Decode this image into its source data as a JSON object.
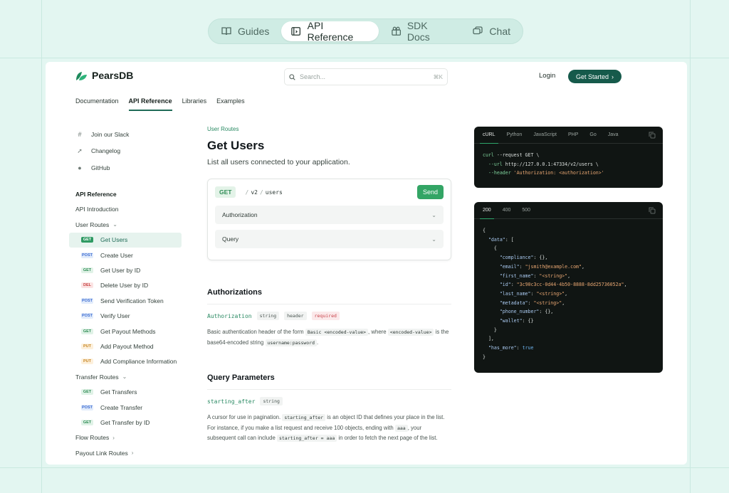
{
  "topnav": {
    "tabs": [
      {
        "label": "Guides",
        "icon": "book-icon",
        "active": false
      },
      {
        "label": "API Reference",
        "icon": "code-square-icon",
        "active": true
      },
      {
        "label": "SDK Docs",
        "icon": "package-icon",
        "active": false
      },
      {
        "label": "Chat",
        "icon": "chat-icon",
        "active": false
      }
    ]
  },
  "header": {
    "brand": "PearsDB",
    "search_placeholder": "Search...",
    "search_shortcut": "⌘K",
    "login": "Login",
    "get_started": "Get Started",
    "get_started_arrow": "›"
  },
  "subnav": {
    "items": [
      "Documentation",
      "API Reference",
      "Libraries",
      "Examples"
    ],
    "active": "API Reference"
  },
  "sidebar": {
    "links": [
      {
        "label": "Join our Slack",
        "icon": "slack-icon"
      },
      {
        "label": "Changelog",
        "icon": "rocket-icon"
      },
      {
        "label": "GitHub",
        "icon": "github-icon"
      }
    ],
    "heading": "API Reference",
    "intro": "API Introduction",
    "user_routes": {
      "label": "User Routes",
      "items": [
        {
          "method": "GET",
          "label": "Get Users",
          "active": true
        },
        {
          "method": "POST",
          "label": "Create User"
        },
        {
          "method": "GET",
          "label": "Get User by ID"
        },
        {
          "method": "DEL",
          "label": "Delete User by ID"
        },
        {
          "method": "POST",
          "label": "Send Verification Token"
        },
        {
          "method": "POST",
          "label": "Verify User"
        },
        {
          "method": "GET",
          "label": "Get Payout Methods"
        },
        {
          "method": "PUT",
          "label": "Add Payout Method"
        },
        {
          "method": "PUT",
          "label": "Add Compliance Information"
        }
      ]
    },
    "transfer_routes": {
      "label": "Transfer Routes",
      "items": [
        {
          "method": "GET",
          "label": "Get Transfers"
        },
        {
          "method": "POST",
          "label": "Create Transfer"
        },
        {
          "method": "GET",
          "label": "Get Transfer by ID"
        }
      ]
    },
    "flow_routes": "Flow Routes",
    "payout_link_routes": "Payout Link Routes"
  },
  "main": {
    "eyebrow": "User Routes",
    "title": "Get Users",
    "description": "List all users connected to your application.",
    "request": {
      "method": "GET",
      "path_parts": [
        "v2",
        "users"
      ],
      "send": "Send",
      "accordions": [
        "Authorization",
        "Query"
      ]
    },
    "authorizations": {
      "title": "Authorizations",
      "param": "Authorization",
      "type": "string",
      "location": "header",
      "required": "required",
      "desc_1": "Basic authentication header of the form",
      "code_1": "Basic <encoded-value>",
      "desc_2": ", where",
      "code_2": "<encoded-value>",
      "desc_3": "is the base64-encoded string",
      "code_3": "username:password",
      "desc_4": "."
    },
    "query": {
      "title": "Query Parameters",
      "param": "starting_after",
      "type": "string",
      "desc_1": "A cursor for use in pagination.",
      "code_1": "starting_after",
      "desc_2": "is an object ID that defines your place in the list. For instance, if you make a list request and receive 100 objects, ending with",
      "code_2": "aaa",
      "desc_3": ", your subsequent call can include",
      "code_3": "starting_after = aaa",
      "desc_4": "in order to fetch the next page of the list."
    }
  },
  "request_panel": {
    "tabs": [
      "cURL",
      "Python",
      "JavaScript",
      "PHP",
      "Go",
      "Java"
    ],
    "active": "cURL",
    "line1_cmd": "curl",
    "line1_rest": " --request GET \\",
    "line2_flag": "  --url",
    "line2_rest": " http://127.0.0.1:47334/v2/users \\",
    "line3_flag": "  --header",
    "line3_str": " 'Authorization: <authorization>'"
  },
  "response_panel": {
    "tabs": [
      "200",
      "400",
      "500"
    ],
    "active": "200",
    "fields": {
      "data": "\"data\"",
      "compliance": "\"compliance\"",
      "email_key": "\"email\"",
      "email_val": "\"jsmith@example.com\"",
      "first_name_key": "\"first_name\"",
      "string_val": "\"<string>\"",
      "id_key": "\"id\"",
      "id_val": "\"3c90c3cc-0d44-4b50-8888-8dd25736052a\"",
      "last_name_key": "\"last_name\"",
      "metadata_key": "\"metadata\"",
      "phone_key": "\"phone_number\"",
      "wallet_key": "\"wallet\"",
      "has_more_key": "\"has_more\"",
      "has_more_val": "true"
    }
  }
}
